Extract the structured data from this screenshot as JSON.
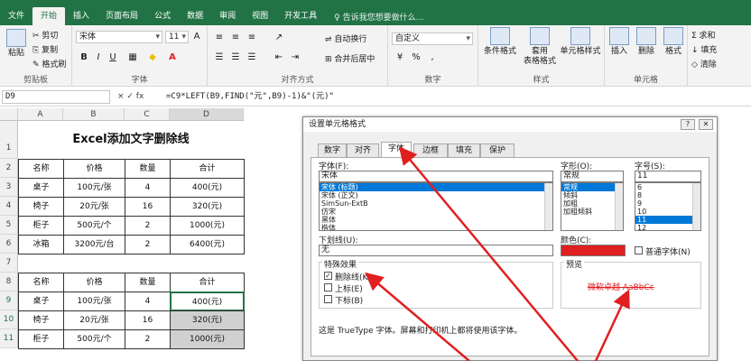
{
  "ribbon_tabs": [
    "文件",
    "开始",
    "插入",
    "页面布局",
    "公式",
    "数据",
    "审阅",
    "视图",
    "开发工具"
  ],
  "tell_me": "♀ 告诉我您想要做什么...",
  "clipboard": {
    "paste": "粘贴",
    "cut": "剪切",
    "copy": "复制",
    "painter": "格式刷",
    "label": "剪贴板"
  },
  "font": {
    "name": "宋体",
    "size": "11",
    "label": "字体",
    "bold": "B",
    "italic": "I",
    "underline": "U"
  },
  "align": {
    "wrap": "自动换行",
    "merge": "合并后居中",
    "label": "对齐方式"
  },
  "number": {
    "format": "自定义",
    "label": "数字",
    "percent": "%",
    "comma": ","
  },
  "styles": {
    "cond": "条件格式",
    "table": "套用\n表格格式",
    "cell": "单元格样式",
    "label": "样式"
  },
  "cells": {
    "insert": "插入",
    "delete": "删除",
    "format": "格式",
    "label": "单元格"
  },
  "editing": {
    "sum": "Σ 求和",
    "fill": "↓ 填充",
    "clear": "◇ 清除"
  },
  "formula_bar": {
    "name": "D9",
    "fx": "× ✓ fx",
    "formula": "=C9*LEFT(B9,FIND(\"元\",B9)-1)&\"(元)\""
  },
  "columns": [
    "A",
    "B",
    "C",
    "D"
  ],
  "rows": [
    "1",
    "2",
    "3",
    "4",
    "5",
    "6",
    "7",
    "8",
    "9",
    "10",
    "11"
  ],
  "sheet": {
    "title": "Excel添加文字删除线",
    "headers": [
      "名称",
      "价格",
      "数量",
      "合计"
    ],
    "table1": [
      [
        "桌子",
        "100元/张",
        "4",
        "400(元)"
      ],
      [
        "椅子",
        "20元/张",
        "16",
        "320(元)"
      ],
      [
        "柜子",
        "500元/个",
        "2",
        "1000(元)"
      ],
      [
        "冰箱",
        "3200元/台",
        "2",
        "6400(元)"
      ]
    ],
    "table2": [
      [
        "桌子",
        "100元/张",
        "4",
        "400(元)"
      ],
      [
        "椅子",
        "20元/张",
        "16",
        "320(元)"
      ],
      [
        "柜子",
        "500元/个",
        "2",
        "1000(元)"
      ]
    ]
  },
  "dialog": {
    "title": "设置单元格格式",
    "tabs": [
      "数字",
      "对齐",
      "字体",
      "边框",
      "填充",
      "保护"
    ],
    "font_label": "字体(F):",
    "font_value": "宋体",
    "font_list": [
      "宋体 (标题)",
      "宋体 (正文)",
      "SimSun-ExtB",
      "仿宋",
      "黑体",
      "楷体"
    ],
    "style_label": "字形(O):",
    "style_value": "常规",
    "style_list": [
      "常规",
      "倾斜",
      "加粗",
      "加粗倾斜"
    ],
    "size_label": "字号(S):",
    "size_value": "11",
    "size_list": [
      "6",
      "8",
      "9",
      "10",
      "11",
      "12"
    ],
    "underline_label": "下划线(U):",
    "underline_value": "无",
    "color_label": "颜色(C):",
    "normal_font": "普通字体(N)",
    "effects_label": "特殊效果",
    "strike": "删除线(K)",
    "sup": "上标(E)",
    "sub": "下标(B)",
    "preview_label": "预览",
    "preview_text": "微软卓越  AaBbCc",
    "note": "这是 TrueType 字体。屏幕和打印机上都将使用该字体。"
  },
  "colors": {
    "excel_green": "#217346",
    "red": "#e02020",
    "preview_red": "#e02020"
  }
}
